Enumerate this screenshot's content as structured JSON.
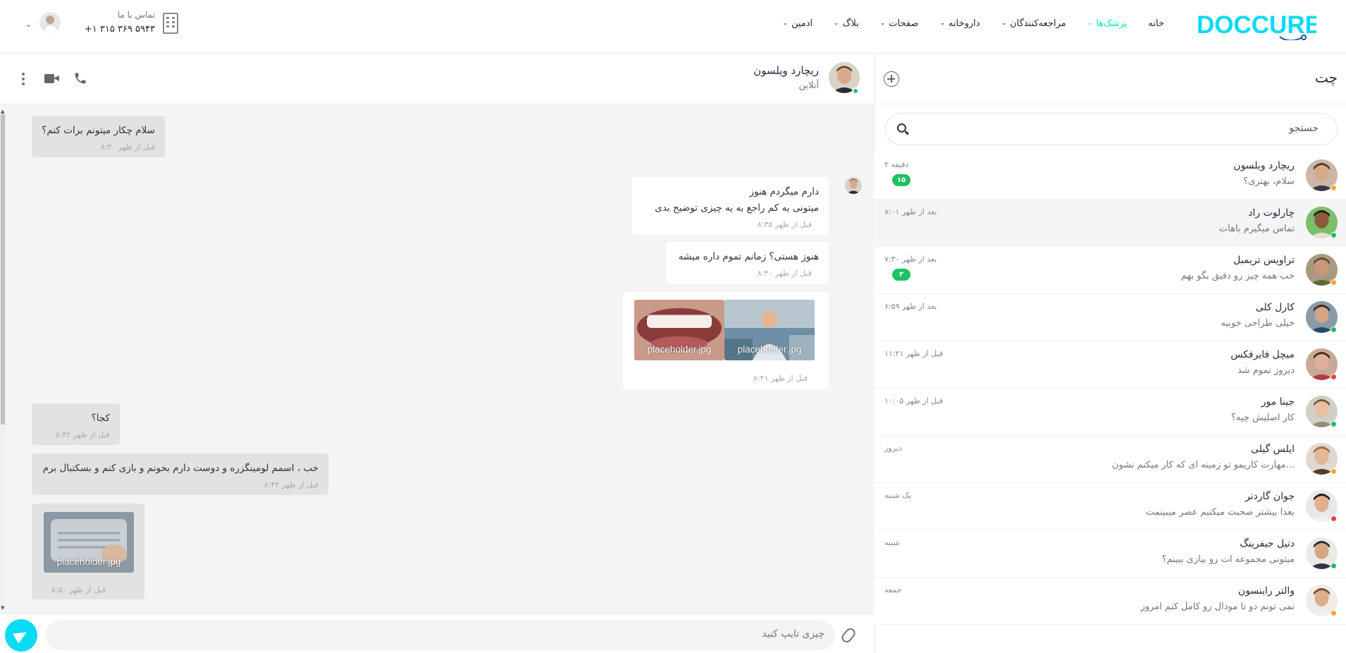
{
  "header": {
    "logo_text": "DOCCURE",
    "nav": [
      {
        "label": "خانه",
        "dropdown": false,
        "active": false
      },
      {
        "label": "پزشک‌ها",
        "dropdown": true,
        "active": true
      },
      {
        "label": "مراجعه‌کنندگان",
        "dropdown": true,
        "active": false
      },
      {
        "label": "داروخانه",
        "dropdown": true,
        "active": false
      },
      {
        "label": "صفحات",
        "dropdown": true,
        "active": false
      },
      {
        "label": "بلاگ",
        "dropdown": true,
        "active": false
      },
      {
        "label": "ادمین",
        "dropdown": true,
        "active": false
      }
    ],
    "contact_label": "تماس با ما",
    "contact_phone": "+۱ ۳۱۵ ۳۶۹ ۵۹۴۳"
  },
  "sidebar": {
    "title": "چت",
    "search_placeholder": "جستجو",
    "contacts": [
      {
        "name": "ریچارد ویلسون",
        "message": "سلام، بهتری؟",
        "time": "۲ دقیقه",
        "badge": "۱۵",
        "status": "away",
        "active": false
      },
      {
        "name": "چارلوت راد",
        "message": "تماس میگیرم باهات",
        "time": "۸:۰۱ بعد از ظهر",
        "badge": "",
        "status": "online",
        "active": true
      },
      {
        "name": "تراویس تریمبل",
        "message": "خب همه چیز رو دقیق بگو بهم",
        "time": "۷:۳۰ بعد از ظهر",
        "badge": "۳",
        "status": "away",
        "active": false
      },
      {
        "name": "کارل کلی",
        "message": "خیلی طراحی خوبیه",
        "time": "۶:۵۹ بعد از ظهر",
        "badge": "",
        "status": "online",
        "active": false
      },
      {
        "name": "میچل فایرفکس",
        "message": "دیروز تموم شد",
        "time": "۱۱:۲۱ قبل از ظهر",
        "badge": "",
        "status": "offline",
        "active": false
      },
      {
        "name": "جینا مور",
        "message": "کار اصلیش چیه؟",
        "time": "۱۰:۰۵ قبل از ظهر",
        "badge": "",
        "status": "online",
        "active": false
      },
      {
        "name": "ایلس گیلی",
        "message": "مهارت کاریمو تو زمینه ای که کار میکنم نشون...",
        "time": "دیروز",
        "badge": "",
        "status": "away",
        "active": false
      },
      {
        "name": "جوان گاردنر",
        "message": "بعدا بیشتر صحبت میکنیم عصر میبینمت",
        "time": "یک شنبه",
        "badge": "",
        "status": "offline",
        "active": false
      },
      {
        "name": "دنیل جیفرینگ",
        "message": "میتونی مجموعه ات رو بیازی ببینم؟",
        "time": "شنبه",
        "badge": "",
        "status": "online",
        "active": false
      },
      {
        "name": "والتر راینسون",
        "message": "نمی تونم دو تا مودال رو کامل کنم امروز",
        "time": "جمعه",
        "badge": "",
        "status": "away",
        "active": false
      }
    ]
  },
  "chat": {
    "contact_name": "ریچارد ویلسون",
    "contact_status": "آنلاین",
    "messages": {
      "m1_text": "سلام چکار میتونم برات کنم؟",
      "m1_time": "۸:۳۰ قبل از ظهر",
      "m2_line1": "دارم میگردم هنوز",
      "m2_line2": "میتونی یه کم راجع به یه چیزی توضیح بدی",
      "m2_time": "۸:۳۵ قبل از ظهر",
      "m3_text": "هنوز هستی؟ زمانم تموم داره میشه",
      "m3_time": "۸:۴۰ قبل از ظهر",
      "m4_img1": "placeholder.jpg",
      "m4_img2": "placeholder.jpg",
      "m4_time": "۸:۴۱ قبل از ظهر",
      "m5_text": "کجا؟",
      "m5_time": "۸:۴۲ قبل از ظهر",
      "m6_text": "خب ، اسمم لومینگزره و دوست دارم بخونم و بازی کنم و بسکتبال برم",
      "m6_time": "۸:۴۲ قبل از ظهر",
      "m7_img": "placeholder.jpg",
      "m7_time": "۸:۵۰ قبل از ظهر"
    },
    "input_placeholder": "چیزی تایپ کنید"
  },
  "colors": {
    "accent": "#09e5ab",
    "brand": "#15558d",
    "send": "#09dbf3",
    "badge": "#20c063",
    "online": "#20c063",
    "away": "#f7a531",
    "offline": "#f33d3d"
  }
}
